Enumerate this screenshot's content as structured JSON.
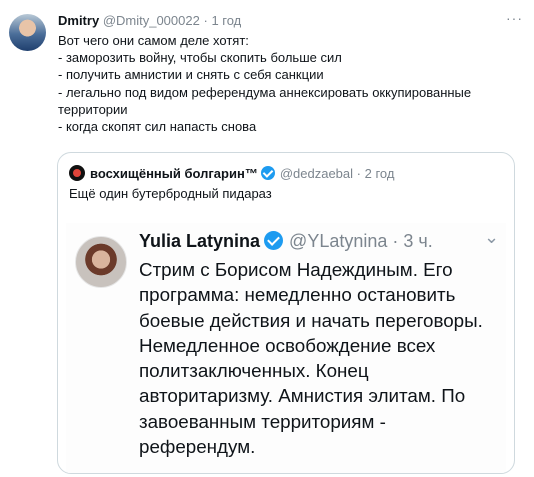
{
  "tweet": {
    "author_name": "Dmitry",
    "handle": "@Dmity_000022",
    "separator": "·",
    "time": "1 год",
    "more_icon": "more-icon",
    "lines": [
      "Вот чего они самом деле хотят:",
      "- заморозить войну, чтобы скопить больше сил",
      "- получить амнистии и снять с себя санкции",
      "- легально под видом референдума аннексировать оккупированные",
      "территории",
      "- когда скопят сил напасть снова"
    ]
  },
  "quote": {
    "author_name": "восхищённый болгарин™",
    "handle": "@dedzaebal",
    "separator": "·",
    "time": "2 год",
    "text": "Ещё один бутербродный пидараз",
    "image": {
      "author_name": "Yulia Latynina",
      "handle": "@YLatynina",
      "separator": "·",
      "time": "3 ч.",
      "more_icon": "more-icon",
      "lines": [
        "Стрим с Борисом Надеждиным. Его",
        "программа: немедленно остановить",
        "боевые действия и начать переговоры.",
        "Немедленное освобождение всех",
        "политзаключенных. Конец",
        "авторитаризму. Амнистия элитам. По",
        "завоеванным территориям -",
        "референдум."
      ]
    }
  },
  "colors": {
    "text": "#0f1419",
    "muted": "#7c858e",
    "verified": "#1d9bf0",
    "border": "#cfd9de"
  }
}
